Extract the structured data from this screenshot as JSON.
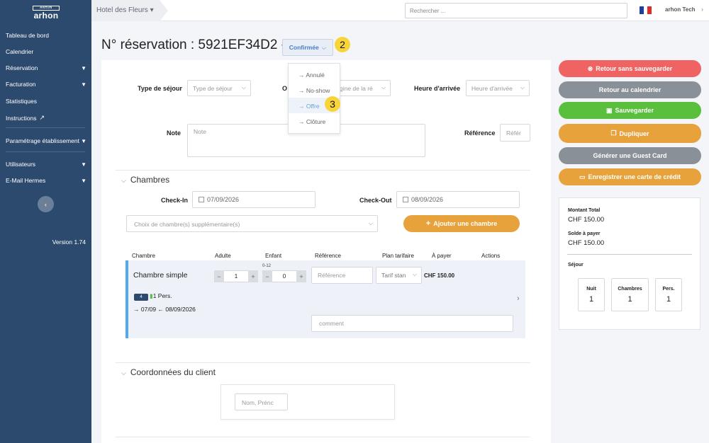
{
  "sidebar": {
    "logo_top": "ARHON",
    "logo_text": "arhon",
    "items": [
      {
        "label": "Tableau de bord"
      },
      {
        "label": "Calendrier"
      },
      {
        "label": "Réservation"
      },
      {
        "label": "Facturation"
      },
      {
        "label": "Statistiques"
      },
      {
        "label": "Instructions"
      },
      {
        "label": "Paramétrage établissement"
      },
      {
        "label": "Utilisateurs"
      },
      {
        "label": "E-Mail Hermes"
      }
    ],
    "version": "Version 1.74"
  },
  "topbar": {
    "hotel": "Hotel des Fleurs",
    "search_placeholder": "Rechercher ...",
    "user": "arhon Tech"
  },
  "header": {
    "title": "N° réservation : 5921EF34D2 -",
    "status": "Confirmée",
    "marker_2": "2",
    "marker_3": "3"
  },
  "status_menu": {
    "items": [
      "→ Annulé",
      "→ No-show",
      "→ Offre",
      "→ Clôture"
    ]
  },
  "form": {
    "type_sejour_label": "Type de séjour",
    "type_sejour_placeholder": "Type de séjour",
    "origin_label_partial": "O",
    "origin_placeholder": "gine de la ré",
    "heure_label": "Heure d'arrivée",
    "heure_placeholder": "Heure d'arrivée",
    "note_label": "Note",
    "note_placeholder": "Note",
    "reference_label": "Référence",
    "reference_placeholder": "Référ"
  },
  "chambres": {
    "title": "Chambres",
    "checkin_label": "Check-In",
    "checkin_value": "07/09/2026",
    "checkout_label": "Check-Out",
    "checkout_value": "08/09/2026",
    "choice_placeholder": "Choix de chambre(s) supplémentaire(s)",
    "add_button": "Ajouter une chambre",
    "columns": [
      "Chambre",
      "Adulte",
      "Enfant",
      "Référence",
      "Plan tarifaire",
      "À payer",
      "Actions"
    ],
    "row": {
      "name": "Chambre simple",
      "adults": "1",
      "child_range": "0-12",
      "children": "0",
      "reference_placeholder": "Référence",
      "tarif": "Tarif stan",
      "price": "CHF 150.00",
      "bed_count": "4",
      "persons": "1 Pers.",
      "dates": "07/09 ← 08/09/2026",
      "comment_placeholder": "comment"
    }
  },
  "client": {
    "title": "Coordonnées du client",
    "name_placeholder": "Nom, Prénc"
  },
  "actions": {
    "back_no_save": "Retour sans sauvegarder",
    "back_calendar": "Retour au calendrier",
    "save": "Sauvegarder",
    "duplicate": "Dupliquer",
    "guest_card": "Générer une Guest Card",
    "credit_card": "Enregistrer une carte de crédit"
  },
  "summary": {
    "total_label": "Montant Total",
    "total_value": "CHF 150.00",
    "balance_label": "Solde à payer",
    "balance_value": "CHF 150.00",
    "stay_label": "Séjour",
    "nights_label": "Nuit",
    "nights_value": "1",
    "rooms_label": "Chambres",
    "rooms_value": "1",
    "pers_label": "Pers.",
    "pers_value": "1"
  },
  "colors": {
    "sidebar": "#2c4a6e",
    "red": "#f06363",
    "grey": "#8a9098",
    "green": "#5bbf3e",
    "orange": "#e8a23b",
    "blue_accent": "#52a9ef",
    "marker": "#f7d53a"
  }
}
